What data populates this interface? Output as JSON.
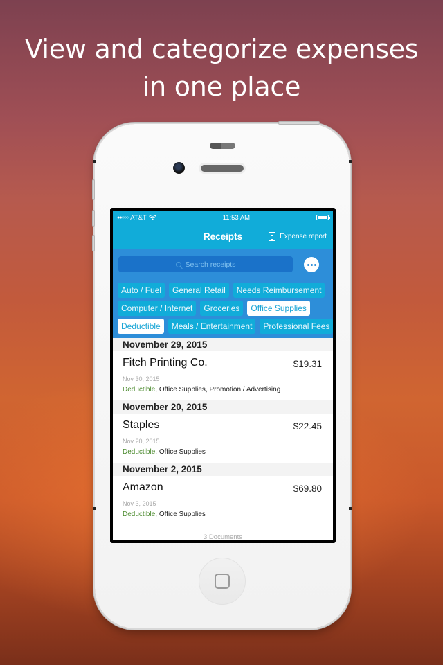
{
  "headline": {
    "line1": "View and categorize expenses",
    "line2": "in one place"
  },
  "status_bar": {
    "signal_icon": "signal-dots-icon",
    "signal": "●●○○○",
    "carrier": "AT&T",
    "wifi_icon": "wifi-icon",
    "time": "11:53 AM",
    "battery_icon": "battery-icon"
  },
  "nav": {
    "title": "Receipts",
    "expense_report_icon": "document-icon",
    "expense_report_label": "Expense report"
  },
  "search": {
    "icon": "search-icon",
    "placeholder": "Search receipts",
    "more_icon": "more-icon"
  },
  "tags": {
    "rows": [
      [
        {
          "label": "Auto / Fuel",
          "active": false
        },
        {
          "label": "General Retail",
          "active": false
        },
        {
          "label": "Needs Reimbursement",
          "active": false
        }
      ],
      [
        {
          "label": "Computer / Internet",
          "active": false
        },
        {
          "label": "Groceries",
          "active": false
        },
        {
          "label": "Office Supplies",
          "active": true
        }
      ],
      [
        {
          "label": "Deductible",
          "active": true
        },
        {
          "label": "Meals / Entertainment",
          "active": false
        },
        {
          "label": "Professional Fees",
          "active": false
        }
      ]
    ]
  },
  "receipts": [
    {
      "section": "November 29, 2015",
      "merchant": "Fitch Printing Co.",
      "amount": "$19.31",
      "date": "Nov 30, 2015",
      "deductible": "Deductible",
      "categories": ", Office Supplies, Promotion / Advertising"
    },
    {
      "section": "November 20, 2015",
      "merchant": "Staples",
      "amount": "$22.45",
      "date": "Nov 20, 2015",
      "deductible": "Deductible",
      "categories": ", Office Supplies"
    },
    {
      "section": "November 2, 2015",
      "merchant": "Amazon",
      "amount": "$69.80",
      "date": "Nov 3, 2015",
      "deductible": "Deductible",
      "categories": ", Office Supplies"
    }
  ],
  "footer": {
    "document_count": "3 Documents"
  },
  "colors": {
    "nav_blue": "#11acd9",
    "search_blue": "#2d8ed9",
    "deductible_green": "#4b8a2e"
  }
}
